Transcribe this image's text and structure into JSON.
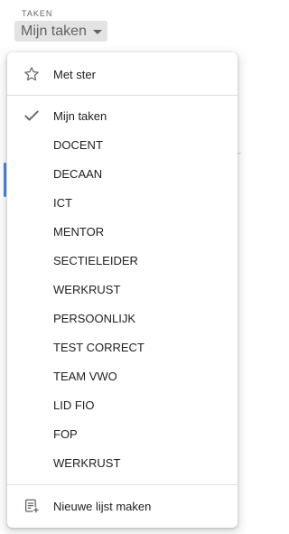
{
  "header": {
    "app_label": "TAKEN",
    "list_selector": "Mijn taken"
  },
  "menu": {
    "starred": "Met ster",
    "lists": [
      {
        "label": "Mijn taken",
        "selected": true
      },
      {
        "label": "DOCENT",
        "selected": false
      },
      {
        "label": "DECAAN",
        "selected": false
      },
      {
        "label": "ICT",
        "selected": false
      },
      {
        "label": "MENTOR",
        "selected": false
      },
      {
        "label": "SECTIELEIDER",
        "selected": false
      },
      {
        "label": "WERKRUST",
        "selected": false
      },
      {
        "label": "PERSOONLIJK",
        "selected": false
      },
      {
        "label": "TEST CORRECT",
        "selected": false
      },
      {
        "label": "TEAM VWO",
        "selected": false
      },
      {
        "label": "LID FIO",
        "selected": false
      },
      {
        "label": "FOP",
        "selected": false
      },
      {
        "label": "WERKRUST",
        "selected": false
      }
    ],
    "new_list": "Nieuwe lijst maken"
  },
  "colors": {
    "accent": "#4a80e8",
    "text": "#202124",
    "muted": "#5f6368"
  }
}
